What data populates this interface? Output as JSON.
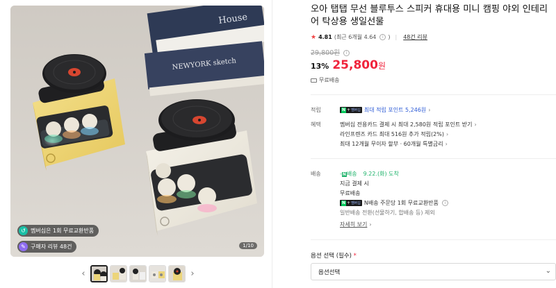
{
  "gallery": {
    "badges": [
      {
        "icon": "membership-icon",
        "label": "멤버십은 1회 무료교환반품"
      },
      {
        "icon": "review-icon",
        "label": "구매자 리뷰 48건"
      }
    ],
    "page_counter": "1/10",
    "thumbnail_count": 5,
    "image_text": {
      "house": "House",
      "newyork": "NEWYORK sketch"
    }
  },
  "product": {
    "title": "오아 탭탭 무선 블루투스 스피커 휴대용 미니 캠핑 야외 인테리어 탁상용 생일선물",
    "rating": "4.81",
    "rating_detail": "(최근 6개월 4.64",
    "rating_detail_close": ")",
    "reviews_link": "48건 리뷰",
    "original_price": "29,800원",
    "discount": "13%",
    "sale_price": "25,800",
    "currency": "원",
    "shipping_free": "무료배송"
  },
  "benefits": {
    "points_label": "적립",
    "points_text": "최대 적립 포인트 5,246원",
    "perks_label": "혜택",
    "perks": [
      "멤버십 전용카드 결제 시 최대 2,580원 적립 포인트 받기",
      "라인프렌즈 카드 최대 516원 추가 적립(2%)",
      "최대 12개월 무이자 할부 · 60개월 특별금리"
    ]
  },
  "delivery": {
    "label": "배송",
    "badge": "배송",
    "date": "9.22.(화) 도착",
    "lines": [
      "지금 결제 시",
      "무료배송"
    ],
    "return_note": "N배송 주문당 1회 무료교환반품",
    "extra_note": "일반배송 전환(선물하기, 합배송 등) 제외",
    "detail_link": "자세히 보기"
  },
  "options": {
    "label": "옵션 선택",
    "required": "(필수)",
    "asterisk": "*",
    "select_value": "옵션선택"
  },
  "npay": {
    "n": "N",
    "plus": "+",
    "membership": "멤버십"
  },
  "colors": {
    "accent": "#f0243c",
    "point_blue": "#2d5bd6",
    "delivery_green": "#1fb36b",
    "npay_green": "#03c75a"
  }
}
